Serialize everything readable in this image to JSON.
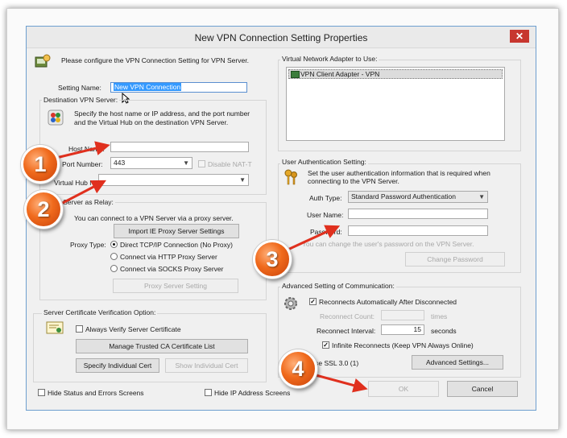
{
  "window": {
    "title": "New VPN Connection Setting Properties",
    "close_glyph": "✕"
  },
  "intro": "Please configure the VPN Connection Setting for VPN Server.",
  "setting_name": {
    "label": "Setting Name:",
    "value": "New VPN Connection"
  },
  "destination": {
    "legend": "Destination VPN Server:",
    "desc_line1": "Specify the host name or IP address, and the port number",
    "desc_line2": "and the Virtual Hub on the destination VPN Server.",
    "host_label": "Host Name:",
    "host_value": "",
    "port_label": "Port Number:",
    "port_value": "443",
    "disable_nat_label": "Disable NAT-T",
    "hub_label": "Virtual Hub Name:",
    "hub_value": ""
  },
  "proxy": {
    "legend": "Proxy Server as Relay:",
    "desc": "You can connect to a VPN Server via a proxy server.",
    "import_button": "Import IE Proxy Server Settings",
    "type_label": "Proxy Type:",
    "options": [
      "Direct TCP/IP Connection (No Proxy)",
      "Connect via HTTP Proxy Server",
      "Connect via SOCKS Proxy Server"
    ],
    "settings_button": "Proxy Server Setting"
  },
  "cert": {
    "legend": "Server Certificate Verification Option:",
    "always_verify_label": "Always Verify Server Certificate",
    "manage_button": "Manage Trusted CA Certificate List",
    "specify_button": "Specify Individual Cert",
    "show_button": "Show Individual Cert"
  },
  "adapter": {
    "legend": "Virtual Network Adapter to Use:",
    "items": [
      "VPN Client Adapter - VPN"
    ]
  },
  "auth": {
    "legend": "User Authentication Setting:",
    "desc_line1": "Set the user authentication information that is required when",
    "desc_line2": "connecting to the VPN Server.",
    "type_label": "Auth Type:",
    "type_value": "Standard Password Authentication",
    "user_label": "User Name:",
    "password_label": "Password:",
    "change_hint": "You can change the user's password on the VPN Server.",
    "change_button": "Change Password"
  },
  "advanced": {
    "legend": "Advanced Setting of Communication:",
    "reconnect_label": "Reconnects Automatically After Disconnected",
    "count_label": "Reconnect Count:",
    "count_unit": "times",
    "interval_label": "Reconnect Interval:",
    "interval_value": "15",
    "interval_unit": "seconds",
    "infinite_label": "Infinite Reconnects (Keep VPN Always Online)",
    "ssl_label": "Use SSL 3.0 (1)",
    "advanced_button": "Advanced Settings..."
  },
  "footer": {
    "hide_status_label": "Hide Status and Errors Screens",
    "hide_ip_label": "Hide IP Address Screens",
    "ok_button": "OK",
    "cancel_button": "Cancel"
  },
  "badges": [
    "1",
    "2",
    "3",
    "4"
  ],
  "colors": {
    "badge": "#f06a1c",
    "arrow": "#e0301e",
    "close": "#c7372f",
    "selection": "#3399ff"
  }
}
